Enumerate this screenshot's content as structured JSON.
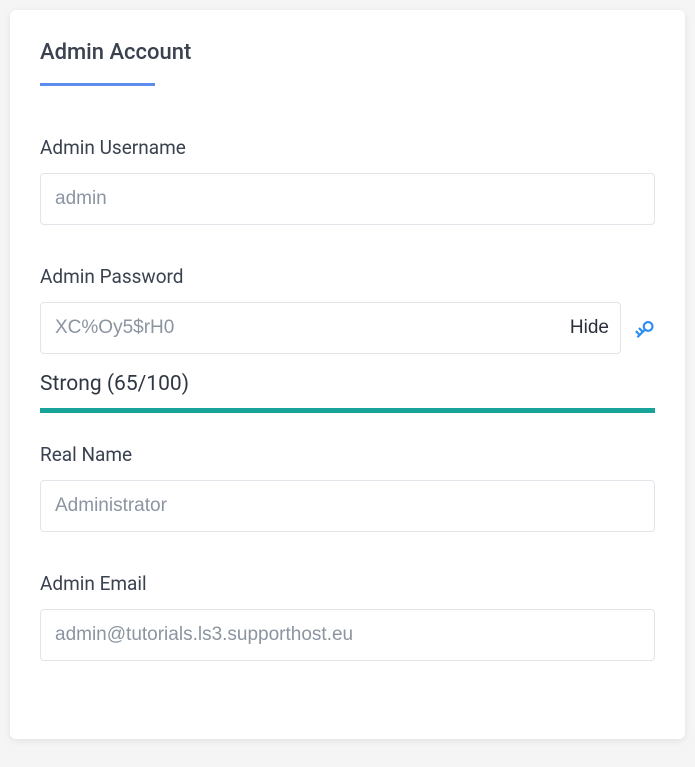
{
  "title": "Admin Account",
  "fields": {
    "username": {
      "label": "Admin Username",
      "value": "admin"
    },
    "password": {
      "label": "Admin Password",
      "value": "XC%Oy5$rH0",
      "toggle_label": "Hide",
      "strength_text": "Strong (65/100)"
    },
    "realname": {
      "label": "Real Name",
      "value": "Administrator"
    },
    "email": {
      "label": "Admin Email",
      "value": "admin@tutorials.ls3.supporthost.eu"
    }
  },
  "colors": {
    "accent": "#5b8def",
    "strength_bar": "#17a398",
    "key_icon": "#2b8ef0"
  }
}
